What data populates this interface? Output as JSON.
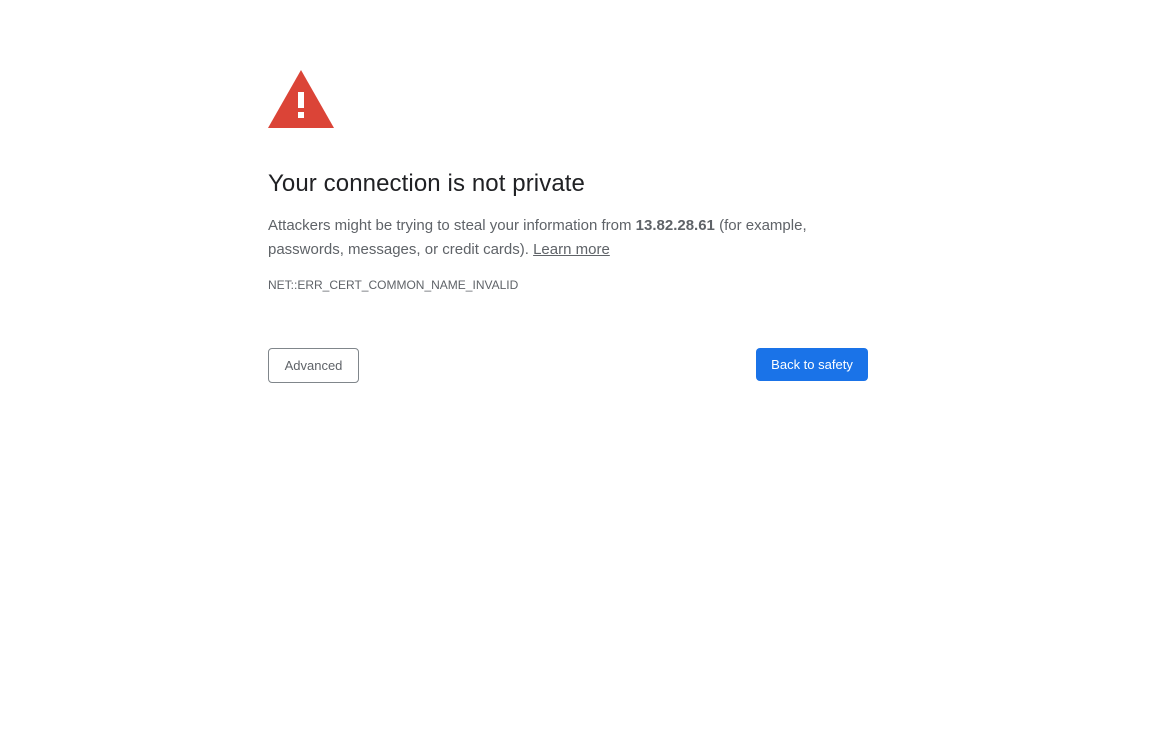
{
  "interstitial": {
    "icon": "warning-triangle-icon",
    "icon_color": "#db4437",
    "title": "Your connection is not private",
    "message_before_host": "Attackers might be trying to steal your information from ",
    "host": "13.82.28.61",
    "message_after_host": " (for example, passwords, messages, or credit cards). ",
    "learn_more_label": "Learn more",
    "error_code": "NET::ERR_CERT_COMMON_NAME_INVALID"
  },
  "buttons": {
    "advanced_label": "Advanced",
    "back_to_safety_label": "Back to safety"
  },
  "colors": {
    "primary_button": "#1a73e8",
    "text": "#5f6368",
    "title": "#202124"
  }
}
